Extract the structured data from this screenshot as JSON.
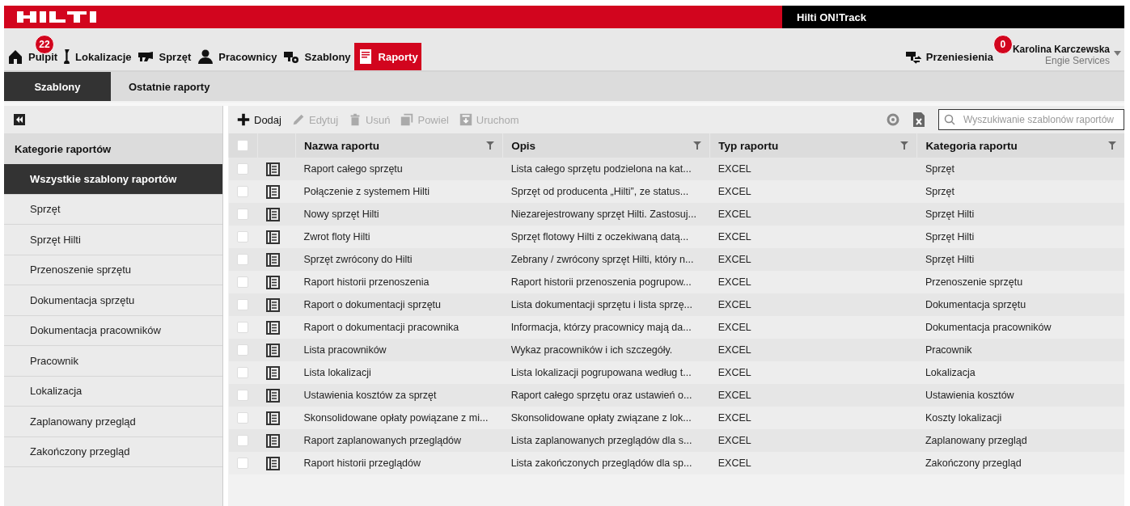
{
  "header": {
    "app_title": "Hilti ON!Track"
  },
  "nav": {
    "items": [
      {
        "label": "Pulpit",
        "badge": "22",
        "selected": false
      },
      {
        "label": "Lokalizacje",
        "selected": false
      },
      {
        "label": "Sprzęt",
        "selected": false
      },
      {
        "label": "Pracownicy",
        "selected": false
      },
      {
        "label": "Szablony",
        "selected": false
      },
      {
        "label": "Raporty",
        "selected": true
      }
    ],
    "transfers": {
      "label": "Przeniesienia"
    },
    "user": {
      "badge": "0",
      "name": "Karolina Karczewska",
      "company": "Engie Services"
    }
  },
  "tabs": [
    {
      "label": "Szablony",
      "selected": true
    },
    {
      "label": "Ostatnie raporty",
      "selected": false
    }
  ],
  "sidebar": {
    "title": "Kategorie raportów",
    "items": [
      {
        "label": "Wszystkie szablony raportów",
        "selected": true
      },
      {
        "label": "Sprzęt",
        "selected": false
      },
      {
        "label": "Sprzęt Hilti",
        "selected": false
      },
      {
        "label": "Przenoszenie sprzętu",
        "selected": false
      },
      {
        "label": "Dokumentacja sprzętu",
        "selected": false
      },
      {
        "label": "Dokumentacja pracowników",
        "selected": false
      },
      {
        "label": "Pracownik",
        "selected": false
      },
      {
        "label": "Lokalizacja",
        "selected": false
      },
      {
        "label": "Zaplanowany przegląd",
        "selected": false
      },
      {
        "label": "Zakończony przegląd",
        "selected": false
      }
    ]
  },
  "toolbar": {
    "buttons": [
      {
        "label": "Dodaj",
        "disabled": false
      },
      {
        "label": "Edytuj",
        "disabled": true
      },
      {
        "label": "Usuń",
        "disabled": true
      },
      {
        "label": "Powiel",
        "disabled": true
      },
      {
        "label": "Uruchom",
        "disabled": true
      }
    ],
    "search": {
      "placeholder": "Wyszukiwanie szablonów raportów"
    }
  },
  "table": {
    "all_checked": false,
    "columns": [
      "Nazwa raportu",
      "Opis",
      "Typ raportu",
      "Kategoria raportu"
    ],
    "rows": [
      {
        "checked": false,
        "cells": [
          "Raport całego sprzętu",
          "Lista całego sprzętu podzielona na kat...",
          "EXCEL",
          "Sprzęt"
        ]
      },
      {
        "checked": false,
        "cells": [
          "Połączenie z systemem Hilti",
          "Sprzęt od producenta „Hilti”, ze status...",
          "EXCEL",
          "Sprzęt"
        ]
      },
      {
        "checked": false,
        "cells": [
          "Nowy sprzęt Hilti",
          "Niezarejestrowany sprzęt Hilti. Zastosuj...",
          "EXCEL",
          "Sprzęt Hilti"
        ]
      },
      {
        "checked": false,
        "cells": [
          "Zwrot floty Hilti",
          "Sprzęt flotowy Hilti z oczekiwaną datą...",
          "EXCEL",
          "Sprzęt Hilti"
        ]
      },
      {
        "checked": false,
        "cells": [
          "Sprzęt zwrócony do Hilti",
          "Zebrany / zwrócony sprzęt Hilti, który n...",
          "EXCEL",
          "Sprzęt Hilti"
        ]
      },
      {
        "checked": false,
        "cells": [
          "Raport historii przenoszenia",
          "Raport historii przenoszenia pogrupow...",
          "EXCEL",
          "Przenoszenie sprzętu"
        ]
      },
      {
        "checked": false,
        "cells": [
          "Raport o dokumentacji sprzętu",
          "Lista dokumentacji sprzętu i lista sprzę...",
          "EXCEL",
          "Dokumentacja sprzętu"
        ]
      },
      {
        "checked": false,
        "cells": [
          "Raport o dokumentacji pracownika",
          "Informacja, którzy pracownicy mają da...",
          "EXCEL",
          "Dokumentacja pracowników"
        ]
      },
      {
        "checked": false,
        "cells": [
          "Lista pracowników",
          "Wykaz pracowników i ich szczegóły.",
          "EXCEL",
          "Pracownik"
        ]
      },
      {
        "checked": false,
        "cells": [
          "Lista lokalizacji",
          "Lista lokalizacji pogrupowana według t...",
          "EXCEL",
          "Lokalizacja"
        ]
      },
      {
        "checked": false,
        "cells": [
          "Ustawienia kosztów za sprzęt",
          "Raport całego sprzętu oraz ustawień o...",
          "EXCEL",
          "Ustawienia kosztów"
        ]
      },
      {
        "checked": false,
        "cells": [
          "Skonsolidowane opłaty powiązane z mi...",
          "Skonsolidowane opłaty związane z lok...",
          "EXCEL",
          "Koszty lokalizacji"
        ]
      },
      {
        "checked": false,
        "cells": [
          "Raport zaplanowanych przeglądów",
          "Lista zaplanowanych przeglądów dla s...",
          "EXCEL",
          "Zaplanowany przegląd"
        ]
      },
      {
        "checked": false,
        "cells": [
          "Raport historii przeglądów",
          "Lista zakończonych przeglądów dla sp...",
          "EXCEL",
          "Zakończony przegląd"
        ]
      }
    ]
  }
}
